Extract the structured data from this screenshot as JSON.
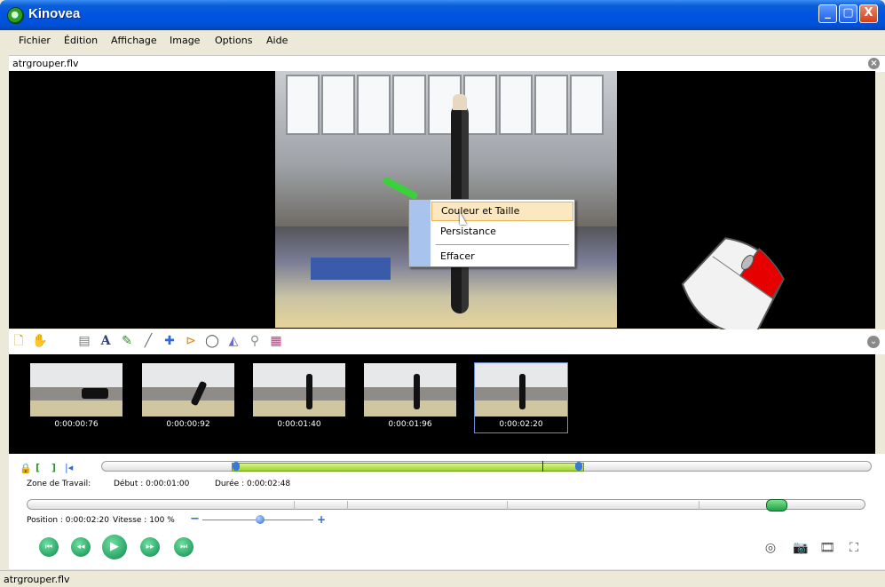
{
  "window": {
    "title": "Kinovea",
    "buttons": {
      "minimize": "_",
      "maximize": "▢",
      "close": "X"
    }
  },
  "menu": {
    "items": [
      "Fichier",
      "Édition",
      "Affichage",
      "Image",
      "Options",
      "Aide"
    ]
  },
  "file_tab": {
    "name": "atrgrouper.flv",
    "close_glyph": "×"
  },
  "context_menu": {
    "items": [
      "Couleur et Taille",
      "Persistance",
      "Effacer"
    ]
  },
  "toolbar": {
    "collapse_glyph": "⌄"
  },
  "thumbnails": [
    {
      "timestamp": "0:00:00:76"
    },
    {
      "timestamp": "0:00:00:92"
    },
    {
      "timestamp": "0:00:01:40"
    },
    {
      "timestamp": "0:00:01:96"
    },
    {
      "timestamp": "0:00:02:20"
    }
  ],
  "working_zone": {
    "label": "Zone de Travail:",
    "start": "Début : 0:00:01:00",
    "duration": "Durée : 0:00:02:48"
  },
  "playback": {
    "position": "Position : 0:00:02:20",
    "speed": "Vitesse : 100 %",
    "speed_minus": "−",
    "speed_plus": "+"
  },
  "statusbar": {
    "text": "atrgrouper.flv"
  },
  "colors": {
    "title_blue": "#0054e3",
    "range_green": "#9fd42e",
    "context_hover": "#fbe7c0",
    "accent_green": "#0f8a4f"
  }
}
